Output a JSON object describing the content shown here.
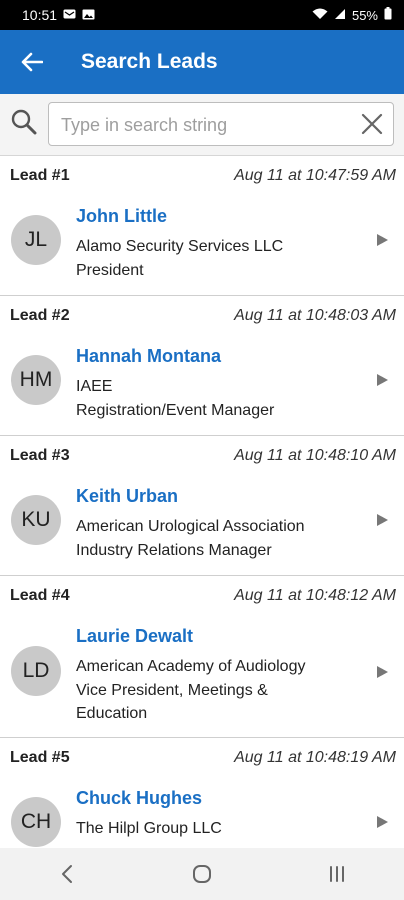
{
  "status": {
    "time": "10:51",
    "battery": "55%"
  },
  "header": {
    "title": "Search Leads"
  },
  "search": {
    "placeholder": "Type in search string",
    "value": ""
  },
  "leads": [
    {
      "number": "Lead #1",
      "time": "Aug 11 at 10:47:59 AM",
      "initials": "JL",
      "name": "John Little",
      "line1": "Alamo Security Services LLC",
      "line2": "President",
      "line3": ""
    },
    {
      "number": "Lead #2",
      "time": "Aug 11 at 10:48:03 AM",
      "initials": "HM",
      "name": "Hannah Montana",
      "line1": "IAEE",
      "line2": "Registration/Event Manager",
      "line3": ""
    },
    {
      "number": "Lead #3",
      "time": "Aug 11 at 10:48:10 AM",
      "initials": "KU",
      "name": "Keith Urban",
      "line1": "American Urological Association",
      "line2": "Industry Relations Manager",
      "line3": ""
    },
    {
      "number": "Lead #4",
      "time": "Aug 11 at 10:48:12 AM",
      "initials": "LD",
      "name": "Laurie Dewalt",
      "line1": "American Academy of Audiology",
      "line2": "Vice President, Meetings &",
      "line3": "Education"
    },
    {
      "number": "Lead #5",
      "time": "Aug 11 at 10:48:19 AM",
      "initials": "CH",
      "name": "Chuck Hughes",
      "line1": "The Hilpl Group LLC",
      "line2": "",
      "line3": ""
    }
  ],
  "icons": {
    "back": "arrow-left-icon",
    "search": "search-icon",
    "clear": "close-icon",
    "chevron": "chevron-right-icon",
    "nav_back": "nav-back-icon",
    "nav_home": "nav-home-icon",
    "nav_recents": "nav-recents-icon"
  },
  "colors": {
    "accent": "#1a6fc4",
    "avatar": "#c9c9c9",
    "status_bar": "#000000"
  }
}
